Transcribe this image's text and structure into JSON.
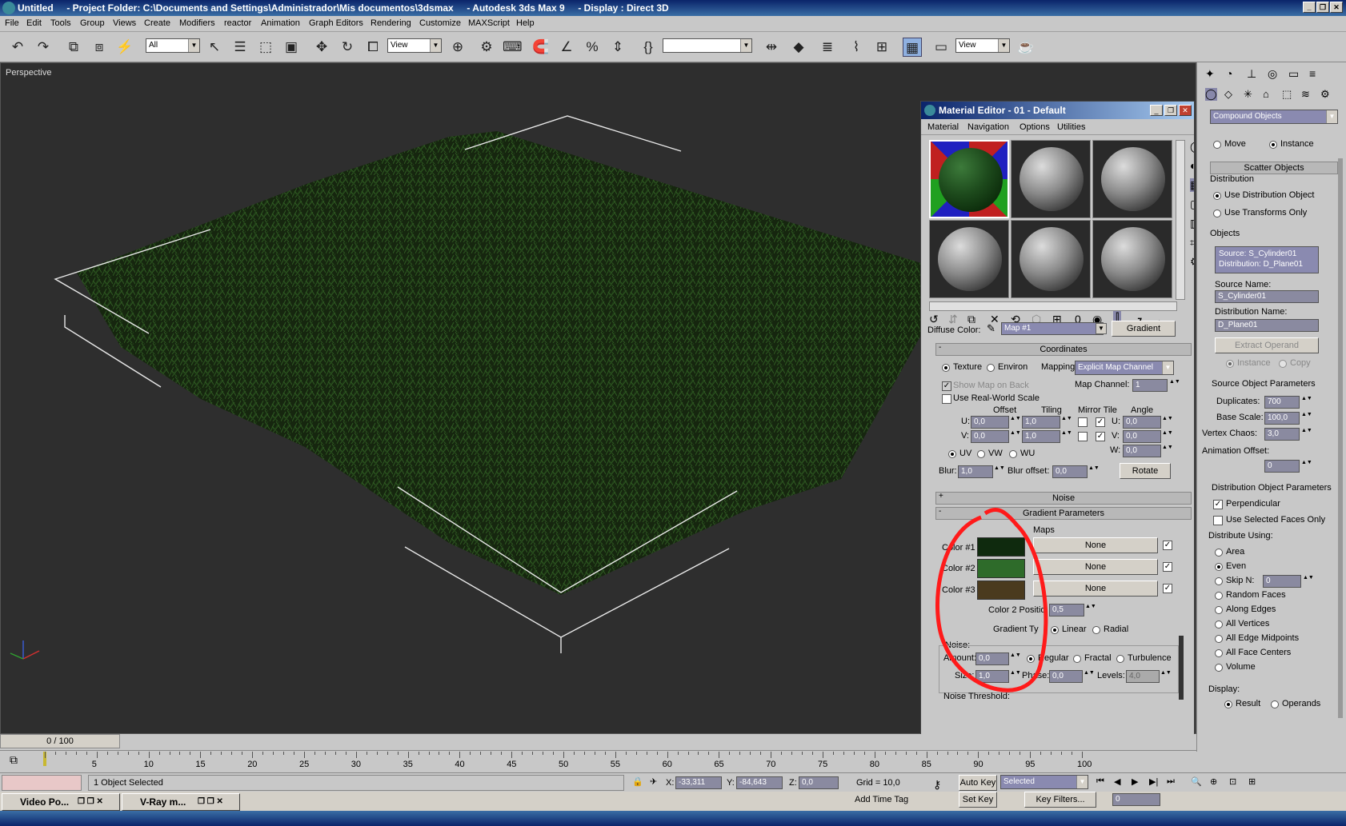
{
  "title": {
    "text": "Untitled     - Project Folder: C:\\Documents and Settings\\Administrador\\Mis documentos\\3dsmax     - Autodesk 3ds Max 9     - Display : Direct 3D"
  },
  "menu": [
    "File",
    "Edit",
    "Tools",
    "Group",
    "Views",
    "Create",
    "Modifiers",
    "reactor",
    "Animation",
    "Graph Editors",
    "Rendering",
    "Customize",
    "MAXScript",
    "Help"
  ],
  "toolbar": {
    "selection_filter": "All",
    "ref_coord": "View",
    "named_sel": "",
    "render_view": "View"
  },
  "viewport": {
    "label": "Perspective"
  },
  "material_editor": {
    "title": "Material Editor - 01 - Default",
    "menu": [
      "Material",
      "Navigation",
      "Options",
      "Utilities"
    ],
    "diffuse_label": "Diffuse Color:",
    "map_name": "Map #1",
    "map_type": "Gradient",
    "coordinates": {
      "header": "Coordinates",
      "texture": "Texture",
      "environ": "Environ",
      "mapping_label": "Mapping:",
      "mapping": "Explicit Map Channel",
      "show_map": "Show Map on Back",
      "map_channel_label": "Map Channel:",
      "map_channel": "1",
      "real_world": "Use Real-World Scale",
      "offset": "Offset",
      "tiling": "Tiling",
      "mirror_tile": "Mirror Tile",
      "angle": "Angle",
      "u_label": "U:",
      "v_label": "V:",
      "w_label": "W:",
      "u_offset": "0,0",
      "v_offset": "0,0",
      "u_tiling": "1,0",
      "v_tiling": "1,0",
      "u_angle": "0,0",
      "v_angle": "0,0",
      "w_angle": "0,0",
      "uv": "UV",
      "vw": "VW",
      "wu": "WU",
      "blur_label": "Blur:",
      "blur": "1,0",
      "blur_offset_label": "Blur offset:",
      "blur_offset": "0,0",
      "rotate": "Rotate"
    },
    "noise_header": "Noise",
    "gradient_header": "Gradient Parameters",
    "maps_label": "Maps",
    "colors": [
      {
        "label": "Color #1",
        "hex": "#0f2a0e",
        "map": "None"
      },
      {
        "label": "Color #2",
        "hex": "#2e6b2a",
        "map": "None"
      },
      {
        "label": "Color #3",
        "hex": "#4a3a1e",
        "map": "None"
      }
    ],
    "color2_pos_label": "Color 2 Positio",
    "color2_pos": "0,5",
    "gradient_type_label": "Gradient Ty",
    "linear": "Linear",
    "radial": "Radial",
    "noise": {
      "label": "Noise:",
      "amount_label": "Amount:",
      "amount": "0,0",
      "regular": "Regular",
      "fractal": "Fractal",
      "turbulence": "Turbulence",
      "size_label": "Size:",
      "size": "1,0",
      "phase_label": "Phase:",
      "phase": "0,0",
      "levels_label": "Levels:",
      "levels": "4,0"
    },
    "noise_threshold": "Noise Threshold:"
  },
  "command_panel": {
    "dropdown": "Compound Objects",
    "move": "Move",
    "instance": "Instance",
    "scatter_header": "Scatter Objects",
    "distribution": "Distribution",
    "use_dist": "Use Distribution Object",
    "use_transforms": "Use Transforms Only",
    "objects": "Objects",
    "obj_list": [
      "Source: S_Cylinder01",
      "Distribution: D_Plane01"
    ],
    "source_name_label": "Source Name:",
    "source_name": "S_Cylinder01",
    "dist_name_label": "Distribution Name:",
    "dist_name": "D_Plane01",
    "extract": "Extract Operand",
    "inst": "Instance",
    "copy": "Copy",
    "src_params": "Source Object Parameters",
    "duplicates_label": "Duplicates:",
    "duplicates": "700",
    "base_scale_label": "Base Scale:",
    "base_scale": "100,0",
    "vertex_chaos_label": "Vertex Chaos:",
    "vertex_chaos": "3,0",
    "anim_offset_label": "Animation Offset:",
    "anim_offset": "0",
    "dist_params": "Distribution Object Parameters",
    "perpendicular": "Perpendicular",
    "use_selected": "Use Selected Faces Only",
    "distribute_using": "Distribute Using:",
    "options": [
      "Area",
      "Even",
      "Skip N:",
      "Random Faces",
      "Along Edges",
      "All Vertices",
      "All Edge Midpoints",
      "All Face Centers",
      "Volume"
    ],
    "skip_n": "0",
    "display": "Display:",
    "result": "Result",
    "operands": "Operands"
  },
  "timeline": {
    "frame": "0 / 100",
    "ticks": [
      "5",
      "10",
      "15",
      "20",
      "25",
      "30",
      "35",
      "40",
      "45",
      "50",
      "55",
      "60",
      "65",
      "70",
      "75",
      "80",
      "85",
      "90",
      "95",
      "100"
    ]
  },
  "status": {
    "selected": "1 Object Selected",
    "x_label": "X:",
    "x": "-33,311",
    "y_label": "Y:",
    "y": "-84,643",
    "z_label": "Z:",
    "z": "0,0",
    "grid": "Grid = 10,0",
    "auto_key": "Auto Key",
    "selected_dd": "Selected",
    "set_key": "Set Key",
    "key_filters": "Key Filters...",
    "add_time_tag": "Add Time Tag",
    "frame_field": "0"
  },
  "taskbar": [
    {
      "label": "Video Po..."
    },
    {
      "label": "V-Ray m..."
    }
  ]
}
